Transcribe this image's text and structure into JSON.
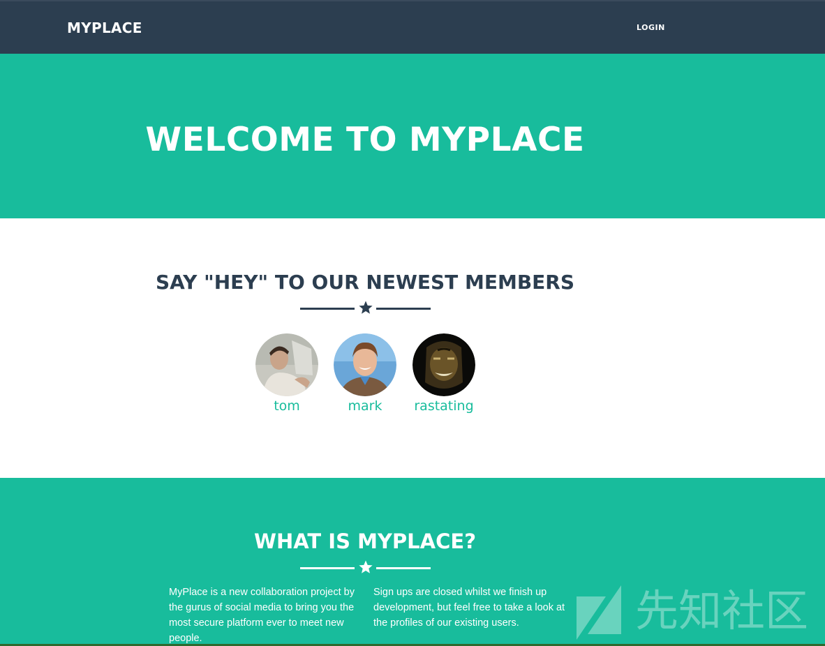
{
  "navbar": {
    "brand": "MYPLACE",
    "login_label": "LOGIN"
  },
  "hero": {
    "title": "WELCOME TO MYPLACE"
  },
  "members_section": {
    "title": "SAY \"HEY\" TO OUR NEWEST MEMBERS",
    "divider_icon": "star-icon",
    "members": [
      {
        "name": "tom"
      },
      {
        "name": "mark"
      },
      {
        "name": "rastating"
      }
    ]
  },
  "about_section": {
    "title": "WHAT IS MYPLACE?",
    "divider_icon": "star-icon",
    "paragraph_left": "MyPlace is a new collaboration project by the gurus of social media to bring you the most secure platform ever to meet new people.",
    "paragraph_right": "Sign ups are closed whilst we finish up development, but feel free to take a look at the profiles of our existing users."
  },
  "watermark": {
    "text": "先知社区"
  },
  "colors": {
    "navbar": "#2c3e50",
    "accent": "#18bc9c",
    "heading_dark": "#2c3e50",
    "white": "#ffffff"
  }
}
